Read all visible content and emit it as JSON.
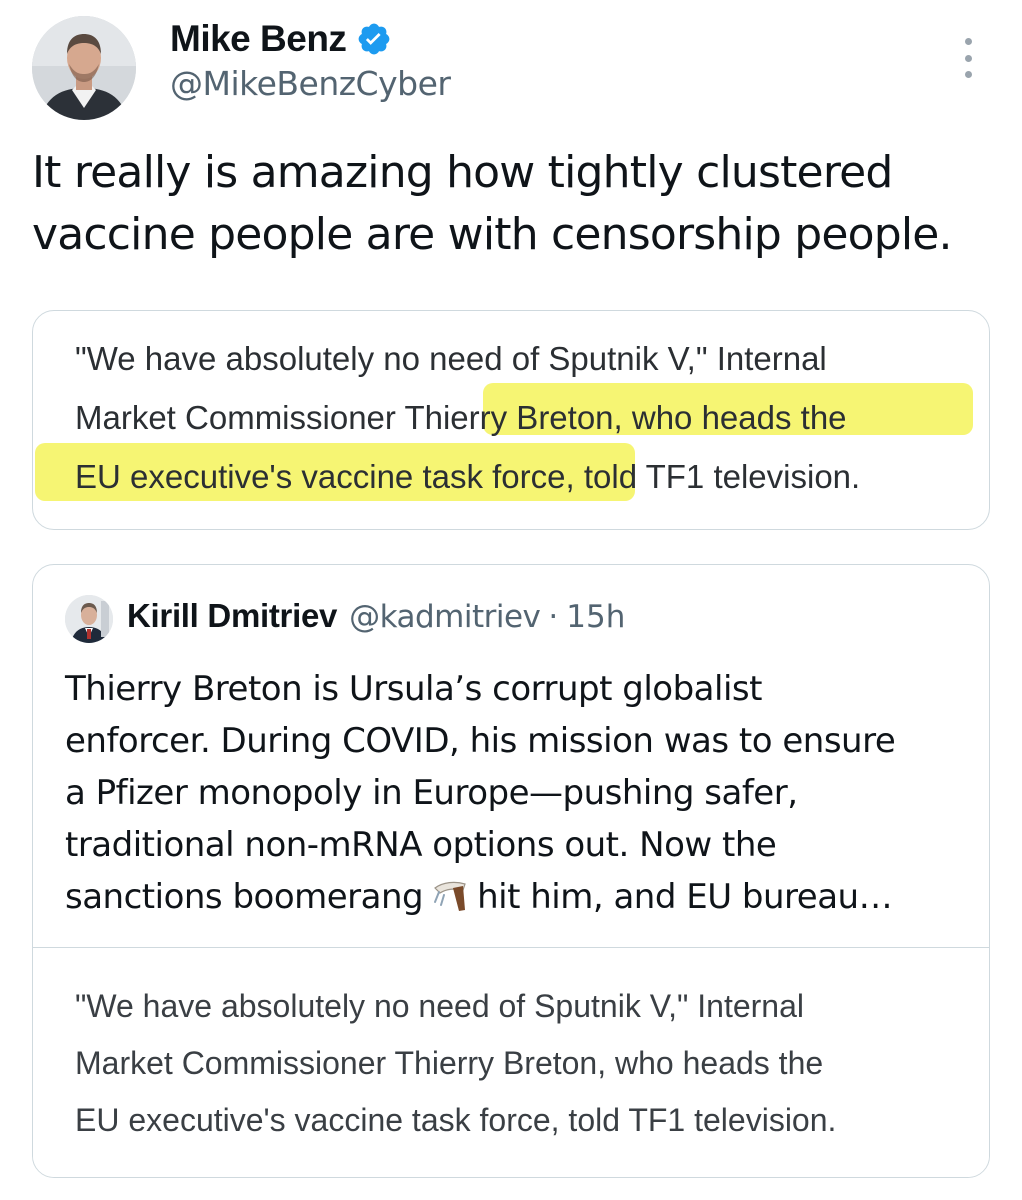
{
  "author": {
    "display_name": "Mike Benz",
    "handle": "@MikeBenzCyber",
    "verified_icon": "verified-badge-icon",
    "accent_color": "#1d9bf0"
  },
  "tweet": {
    "text": "It really is amazing how tightly clustered\nvaccine people are with censorship people."
  },
  "attached_image": {
    "excerpt": "\"We have absolutely no need of Sputnik V,\" Internal\nMarket Commissioner Thierry Breton, who heads the\nEU executive's vaccine task force, told TF1 television.",
    "highlight_color": "#f4f35a"
  },
  "quoted_tweet": {
    "display_name": "Kirill Dmitriev",
    "handle": "@kadmitriev",
    "separator": "·",
    "time": "15h",
    "lines": [
      "Thierry Breton is Ursula’s corrupt globalist",
      "enforcer. During COVID, his mission was to ensure",
      "a Pfizer monopoly in Europe—pushing safer,",
      "traditional non-mRNA options out. Now the"
    ],
    "last_line_before": "sanctions boomerang",
    "emoji_icon": "boomerang-icon",
    "last_line_after": "hit him, and EU bureau…",
    "media_excerpt": "\"We have absolutely no need of Sputnik V,\" Internal\nMarket Commissioner Thierry Breton, who heads the\nEU executive's vaccine task force, told TF1 television."
  },
  "icons": {
    "more_menu": "more-options-icon",
    "author_avatar": "avatar",
    "quoted_avatar": "avatar"
  }
}
